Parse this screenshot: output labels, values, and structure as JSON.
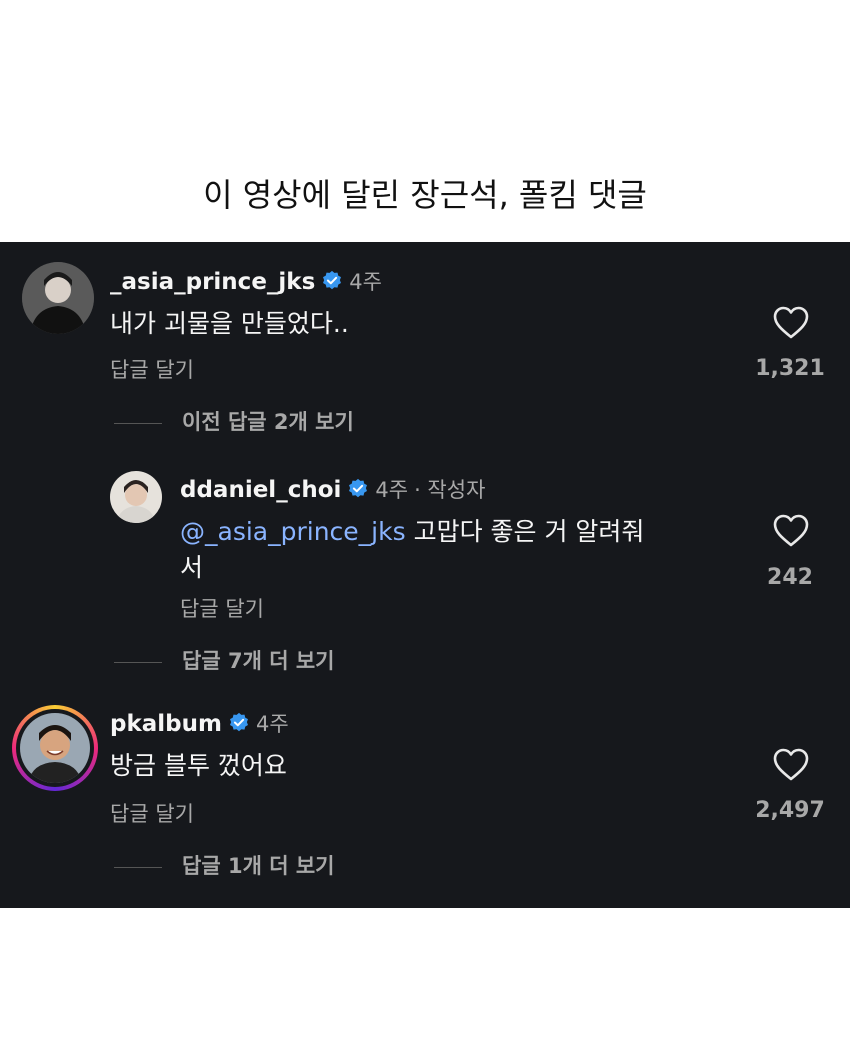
{
  "caption": "이 영상에 달린 장근석, 폴킴 댓글",
  "comments": [
    {
      "username": "_asia_prince_jks",
      "time": "4주",
      "text": "내가 괴물을 만들었다..",
      "reply_label": "답글 달기",
      "likes": "1,321",
      "more_replies": "이전 답글 2개 보기"
    },
    {
      "username": "ddaniel_choi",
      "time": "4주",
      "author_tag": "· 작성자",
      "mention": "@_asia_prince_jks",
      "text_line1": "고맙다 좋은 거 알려줘",
      "text_line2": "서",
      "reply_label": "답글 달기",
      "likes": "242",
      "more_replies": "답글 7개 더 보기"
    },
    {
      "username": "pkalbum",
      "time": "4주",
      "text": "방금 블투 껐어요",
      "reply_label": "답글 달기",
      "likes": "2,497",
      "more_replies": "답글 1개 더 보기"
    }
  ],
  "colors": {
    "panel_bg": "#16181c",
    "verified_blue": "#3897f0",
    "mention_blue": "#8ab4ff",
    "story_ring": [
      "#f9ce34",
      "#ee2a7b",
      "#6228d7"
    ]
  }
}
